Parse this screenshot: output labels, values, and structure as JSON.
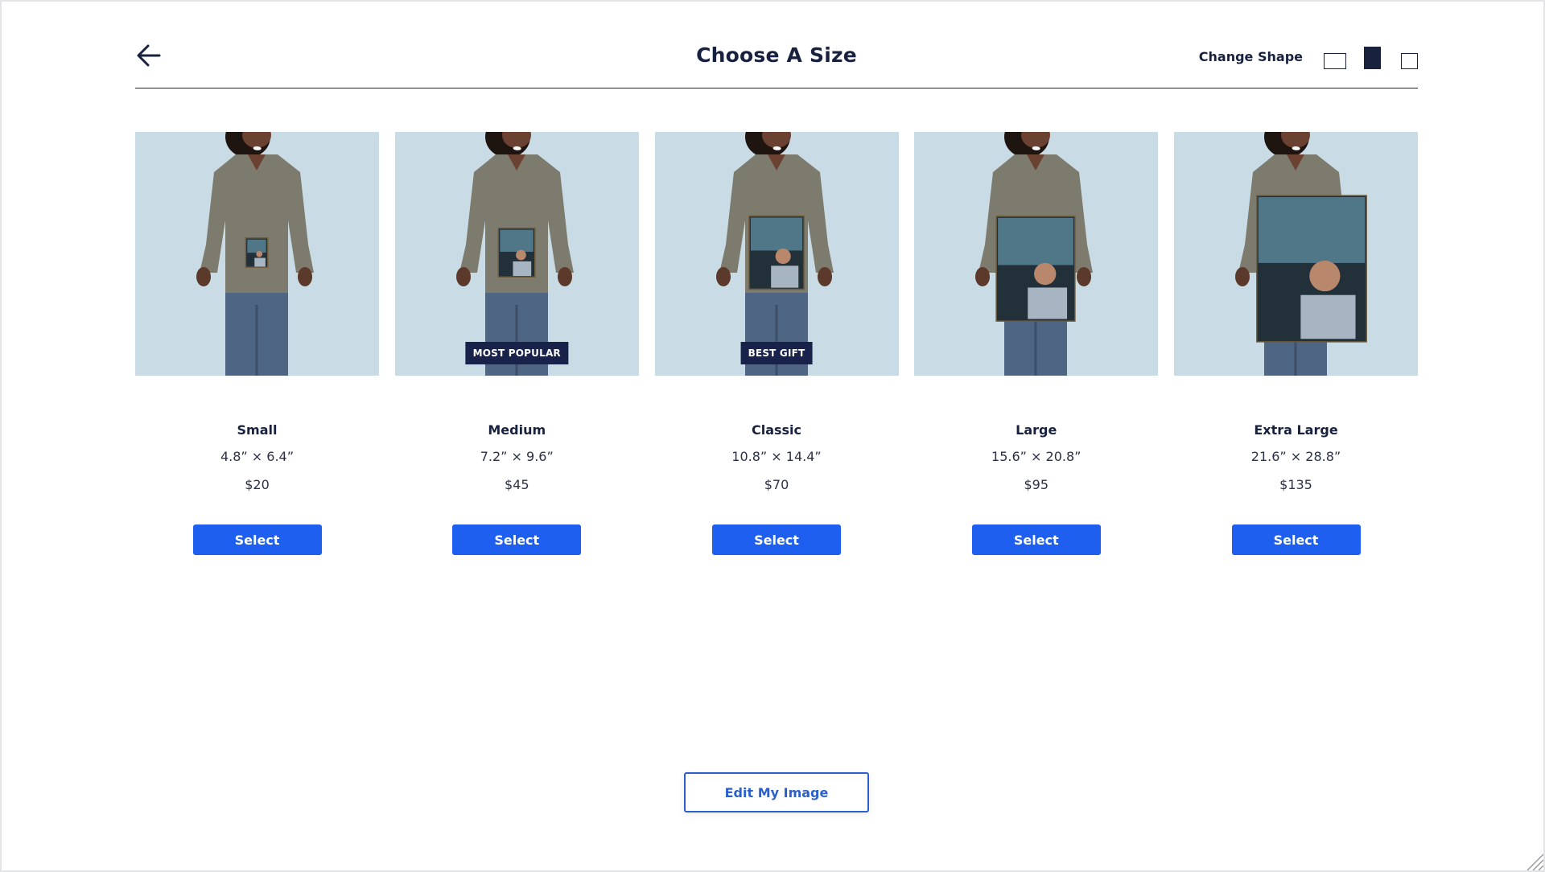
{
  "header": {
    "title": "Choose A Size",
    "back_icon": "arrow-left-icon",
    "change_shape_label": "Change Shape",
    "shapes": [
      {
        "name": "landscape",
        "active": false
      },
      {
        "name": "portrait",
        "active": true
      },
      {
        "name": "square",
        "active": false
      }
    ]
  },
  "products": [
    {
      "name": "Small",
      "dims": "4.8” × 6.4”",
      "price": "$20",
      "badge": "",
      "button": "Select",
      "print_scale": 0.12
    },
    {
      "name": "Medium",
      "dims": "7.2” × 9.6”",
      "price": "$45",
      "badge": "MOST POPULAR",
      "button": "Select",
      "print_scale": 0.2
    },
    {
      "name": "Classic",
      "dims": "10.8” × 14.4”",
      "price": "$70",
      "badge": "BEST GIFT",
      "button": "Select",
      "print_scale": 0.3
    },
    {
      "name": "Large",
      "dims": "15.6” × 20.8”",
      "price": "$95",
      "badge": "",
      "button": "Select",
      "print_scale": 0.43
    },
    {
      "name": "Extra Large",
      "dims": "21.6” × 28.8”",
      "price": "$135",
      "badge": "",
      "button": "Select",
      "print_scale": 0.6
    }
  ],
  "footer": {
    "edit_button": "Edit My Image"
  },
  "colors": {
    "primary": "#1f5fef",
    "navy": "#18223f",
    "badge_bg": "#18224a",
    "photo_bg": "#c9dce6"
  }
}
